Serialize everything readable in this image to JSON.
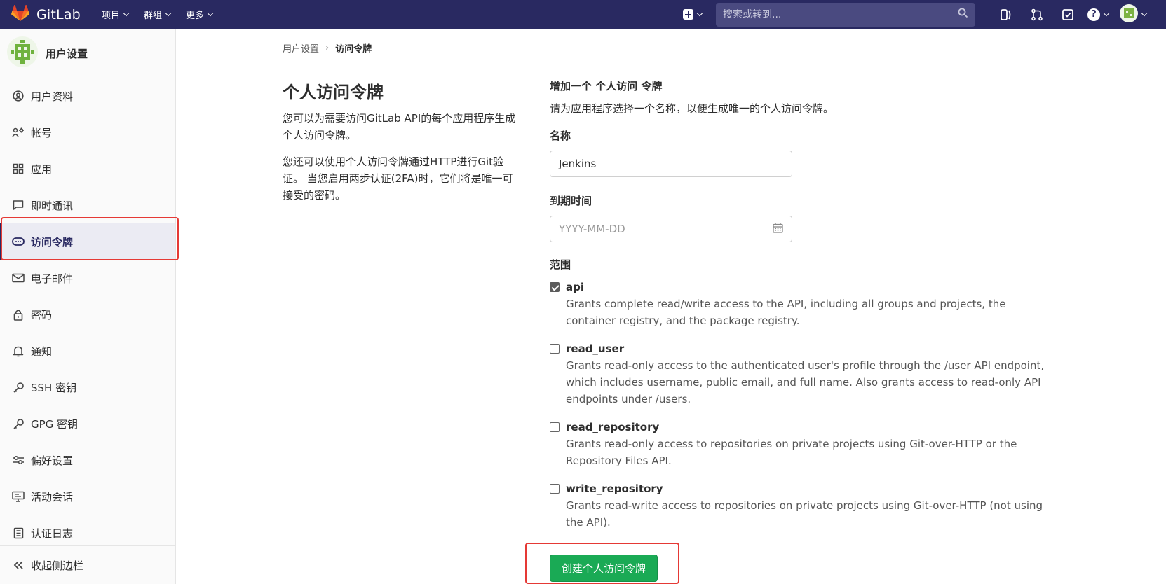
{
  "navbar": {
    "brand": "GitLab",
    "menu": [
      {
        "label": "项目"
      },
      {
        "label": "群组"
      },
      {
        "label": "更多"
      }
    ],
    "search_placeholder": "搜索或转到..."
  },
  "sidebar": {
    "title": "用户设置",
    "items": [
      {
        "label": "用户资料",
        "icon": "profile-icon"
      },
      {
        "label": "帐号",
        "icon": "account-icon"
      },
      {
        "label": "应用",
        "icon": "applications-icon"
      },
      {
        "label": "即时通讯",
        "icon": "chat-icon"
      },
      {
        "label": "访问令牌",
        "icon": "token-icon",
        "active": true
      },
      {
        "label": "电子邮件",
        "icon": "mail-icon"
      },
      {
        "label": "密码",
        "icon": "lock-icon"
      },
      {
        "label": "通知",
        "icon": "bell-icon"
      },
      {
        "label": "SSH 密钥",
        "icon": "key-icon"
      },
      {
        "label": "GPG 密钥",
        "icon": "key-icon"
      },
      {
        "label": "偏好设置",
        "icon": "preferences-icon"
      },
      {
        "label": "活动会话",
        "icon": "monitor-icon"
      },
      {
        "label": "认证日志",
        "icon": "log-icon"
      }
    ],
    "collapse_label": "收起侧边栏"
  },
  "breadcrumb": {
    "parent": "用户设置",
    "current": "访问令牌"
  },
  "intro": {
    "title": "个人访问令牌",
    "para1": "您可以为需要访问GitLab API的每个应用程序生成个人访问令牌。",
    "para2": "您还可以使用个人访问令牌通过HTTP进行Git验证。 当您启用两步认证(2FA)时，它们将是唯一可接受的密码。"
  },
  "form": {
    "section_title": "增加一个 个人访问 令牌",
    "section_desc": "请为应用程序选择一个名称，以便生成唯一的个人访问令牌。",
    "name_label": "名称",
    "name_value": "Jenkins",
    "expiry_label": "到期时间",
    "expiry_placeholder": "YYYY-MM-DD",
    "scopes_label": "范围",
    "scopes": [
      {
        "name": "api",
        "checked": true,
        "desc": "Grants complete read/write access to the API, including all groups and projects, the container registry, and the package registry."
      },
      {
        "name": "read_user",
        "checked": false,
        "desc": "Grants read-only access to the authenticated user's profile through the /user API endpoint, which includes username, public email, and full name. Also grants access to read-only API endpoints under /users."
      },
      {
        "name": "read_repository",
        "checked": false,
        "desc": "Grants read-only access to repositories on private projects using Git-over-HTTP or the Repository Files API."
      },
      {
        "name": "write_repository",
        "checked": false,
        "desc": "Grants read-write access to repositories on private projects using Git-over-HTTP (not using the API)."
      }
    ],
    "submit_label": "创建个人访问令牌"
  },
  "colors": {
    "navbar": "#292961",
    "primary_button": "#1aaa55",
    "highlight": "#e53935"
  }
}
